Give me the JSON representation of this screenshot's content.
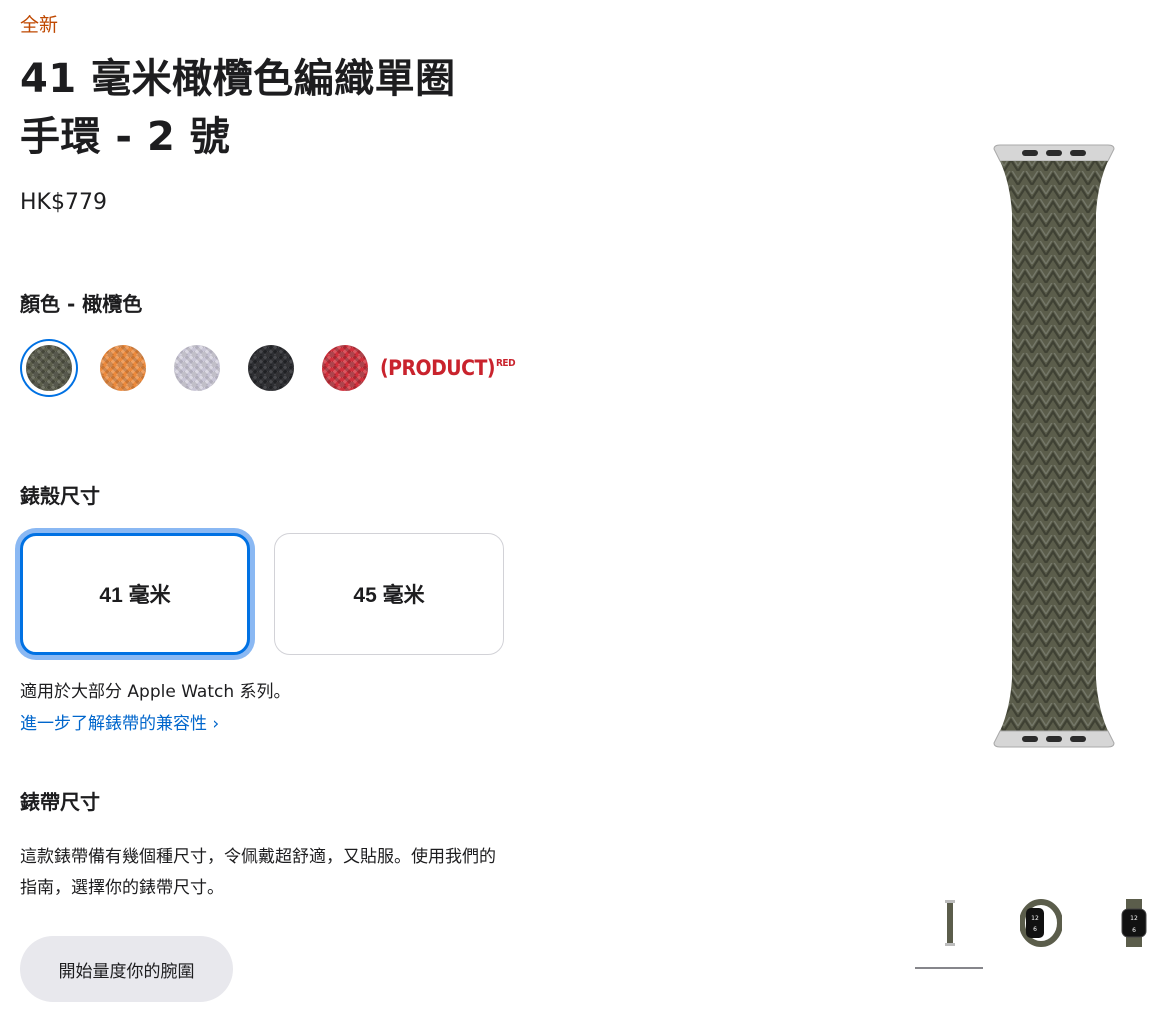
{
  "product": {
    "new_tag": "全新",
    "title_line1": "41 毫米橄欖色編織單圈",
    "title_line2": "手環 - 2 號",
    "price": "HK$779"
  },
  "color": {
    "label": "顏色 - 橄欖色",
    "swatches": [
      {
        "name": "橄欖色",
        "color": "#5c5e4c",
        "selected": true
      },
      {
        "name": "橙色",
        "color": "#ec8a3c",
        "selected": false
      },
      {
        "name": "淺紫色",
        "color": "#c9c6d6",
        "selected": false
      },
      {
        "name": "黑色",
        "color": "#2e2f33",
        "selected": false
      },
      {
        "name": "紅色",
        "color": "#d2303c",
        "selected": false
      }
    ],
    "product_red_text": "(PRODUCT)",
    "product_red_sup": "RED"
  },
  "case_size": {
    "label": "錶殼尺寸",
    "options": [
      {
        "label": "41 毫米",
        "selected": true
      },
      {
        "label": "45 毫米",
        "selected": false
      }
    ],
    "compat_text": "適用於大部分 Apple Watch 系列。",
    "learn_more": "進一步了解錶帶的兼容性 ›"
  },
  "band_size": {
    "label": "錶帶尺寸",
    "description": "這款錶帶備有幾個種尺寸，令佩戴超舒適，又貼服。使用我們的指南，選擇你的錶帶尺寸。",
    "button": "開始量度你的腕圍"
  },
  "colors": {
    "accent": "#0071e3",
    "link": "#0066cc",
    "new_tag": "#bf4800",
    "band": "#5b5d4b"
  }
}
